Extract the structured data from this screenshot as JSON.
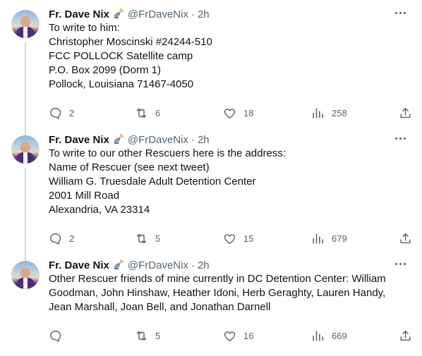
{
  "tweets": [
    {
      "author_name": "Fr. Dave Nix",
      "badge_icon": "satellite-dish-icon",
      "handle": "@FrDaveNix",
      "separator": "·",
      "time": "2h",
      "lines": [
        "To write to him:",
        "Christopher Moscinski #24244-510",
        "FCC POLLOCK Satellite camp",
        "P.O. Box 2099 (Dorm 1)",
        "Pollock, Louisiana 71467-4050"
      ],
      "replies": "2",
      "reposts": "6",
      "likes": "18",
      "views": "258"
    },
    {
      "author_name": "Fr. Dave Nix",
      "badge_icon": "satellite-dish-icon",
      "handle": "@FrDaveNix",
      "separator": "·",
      "time": "2h",
      "lines": [
        "To write to our other Rescuers here is the address:",
        "Name of Rescuer (see next tweet)",
        "William G. Truesdale Adult Detention Center",
        "2001 Mill Road",
        "Alexandria, VA 23314"
      ],
      "replies": "2",
      "reposts": "5",
      "likes": "15",
      "views": "679"
    },
    {
      "author_name": "Fr. Dave Nix",
      "badge_icon": "satellite-dish-icon",
      "handle": "@FrDaveNix",
      "separator": "·",
      "time": "2h",
      "lines": [
        "Other Rescuer friends of mine currently in DC Detention Center: William",
        "Goodman, John Hinshaw, Heather Idoni, Herb Geraghty, Lauren Handy,",
        "Jean Marshall, Joan Bell, and Jonathan Darnell"
      ],
      "replies": "",
      "reposts": "5",
      "likes": "16",
      "views": "669"
    }
  ],
  "colors": {
    "text_primary": "#0f1419",
    "text_secondary": "#536471",
    "thread_line": "#cfd9de",
    "divider": "#eff3f4",
    "robe": "#4d2c79"
  }
}
